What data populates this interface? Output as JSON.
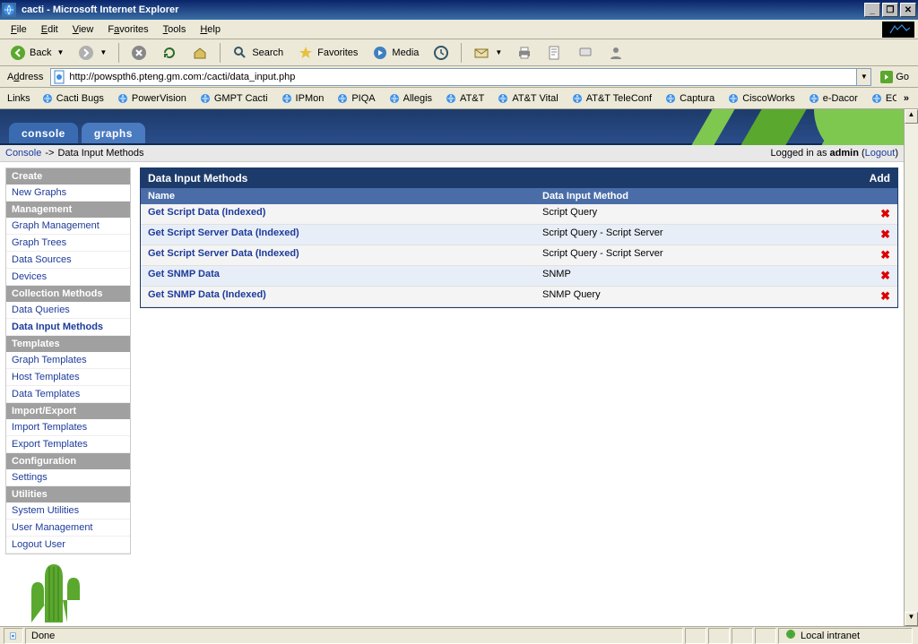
{
  "window": {
    "title": "cacti - Microsoft Internet Explorer"
  },
  "menubar": [
    "File",
    "Edit",
    "View",
    "Favorites",
    "Tools",
    "Help"
  ],
  "toolbar": {
    "back": "Back",
    "search": "Search",
    "favorites": "Favorites",
    "media": "Media"
  },
  "addressbar": {
    "label": "Address",
    "url": "http://powspth6.pteng.gm.com:/cacti/data_input.php",
    "go": "Go"
  },
  "linksbar": {
    "label": "Links",
    "items": [
      "Cacti Bugs",
      "PowerVision",
      "GMPT Cacti",
      "IPMon",
      "PIQA",
      "Allegis",
      "AT&T",
      "AT&T Vital",
      "AT&T TeleConf",
      "Captura",
      "CiscoWorks",
      "e-Dacor",
      "ECM"
    ]
  },
  "tabs": {
    "console": "console",
    "graphs": "graphs"
  },
  "breadcrumb": {
    "root": "Console",
    "current": "Data Input Methods",
    "logged_prefix": "Logged in as ",
    "user": "admin",
    "logout": "Logout"
  },
  "sidebar": {
    "sections": [
      {
        "head": "Create",
        "items": [
          "New Graphs"
        ]
      },
      {
        "head": "Management",
        "items": [
          "Graph Management",
          "Graph Trees",
          "Data Sources",
          "Devices"
        ]
      },
      {
        "head": "Collection Methods",
        "items": [
          "Data Queries",
          "Data Input Methods"
        ],
        "active": "Data Input Methods"
      },
      {
        "head": "Templates",
        "items": [
          "Graph Templates",
          "Host Templates",
          "Data Templates"
        ]
      },
      {
        "head": "Import/Export",
        "items": [
          "Import Templates",
          "Export Templates"
        ]
      },
      {
        "head": "Configuration",
        "items": [
          "Settings"
        ]
      },
      {
        "head": "Utilities",
        "items": [
          "System Utilities",
          "User Management",
          "Logout User"
        ]
      }
    ]
  },
  "panel": {
    "title": "Data Input Methods",
    "add": "Add",
    "col_name": "Name",
    "col_method": "Data Input Method",
    "rows": [
      {
        "name": "Get Script Data (Indexed)",
        "method": "Script Query"
      },
      {
        "name": "Get Script Server Data (Indexed)",
        "method": "Script Query - Script Server"
      },
      {
        "name": "Get Script Server Data (Indexed)",
        "method": "Script Query - Script Server"
      },
      {
        "name": "Get SNMP Data",
        "method": "SNMP"
      },
      {
        "name": "Get SNMP Data (Indexed)",
        "method": "SNMP Query"
      }
    ]
  },
  "statusbar": {
    "done": "Done",
    "zone": "Local intranet"
  }
}
